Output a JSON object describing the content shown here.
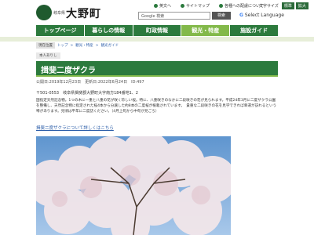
{
  "header": {
    "org_small": "岐阜県",
    "org_name": "大野町",
    "links": [
      "英文へ",
      "サイトマップ",
      "各種への配慮について",
      "お問い合わせ"
    ],
    "font_size_label": "文字サイズ",
    "font_buttons": [
      "標準",
      "拡大"
    ],
    "search_placeholder": "Google 検索",
    "search_button": "検索",
    "language_label": "Select Language"
  },
  "nav": {
    "items": [
      "トップページ",
      "暮らしの情報",
      "町政情報",
      "観光・特産",
      "施設ガイド"
    ],
    "active_index": 3
  },
  "breadcrumb": {
    "label": "現在位置",
    "items": [
      "トップ",
      "観光・特産",
      "観光ガイド"
    ]
  },
  "print_label": "本人ありし",
  "page": {
    "title": "揖斐二度ザクラ",
    "meta": "公開日:2019年12月23日　更新日:2022年6月24日　ID:497",
    "address": "〒501-0553　岐阜県揖斐郡大野町大字南方184番地1、2",
    "description": "国指定天然記念物。1つの木に一重と八重の花が咲く珍しい桜。特に、八重咲きのなかに二段咲きの花が見られます。平成24年3月に二度ザクラ公園を整備し、天然記念物に指定された桜4本から分譲した約8本の二度桜が植栽されています。　貴重な二段咲きの花を見学できれば幸運が訪れるという噂があります。見頃は平年に二度訪ください。（4月上旬から中旬が見ごろ）",
    "link_text": "揖斐二度ザクラについて詳しくはこちら"
  },
  "colors": {
    "nav_green": "#2c7a3d",
    "nav_active": "#83b94a",
    "link_blue": "#2a5ca8"
  }
}
